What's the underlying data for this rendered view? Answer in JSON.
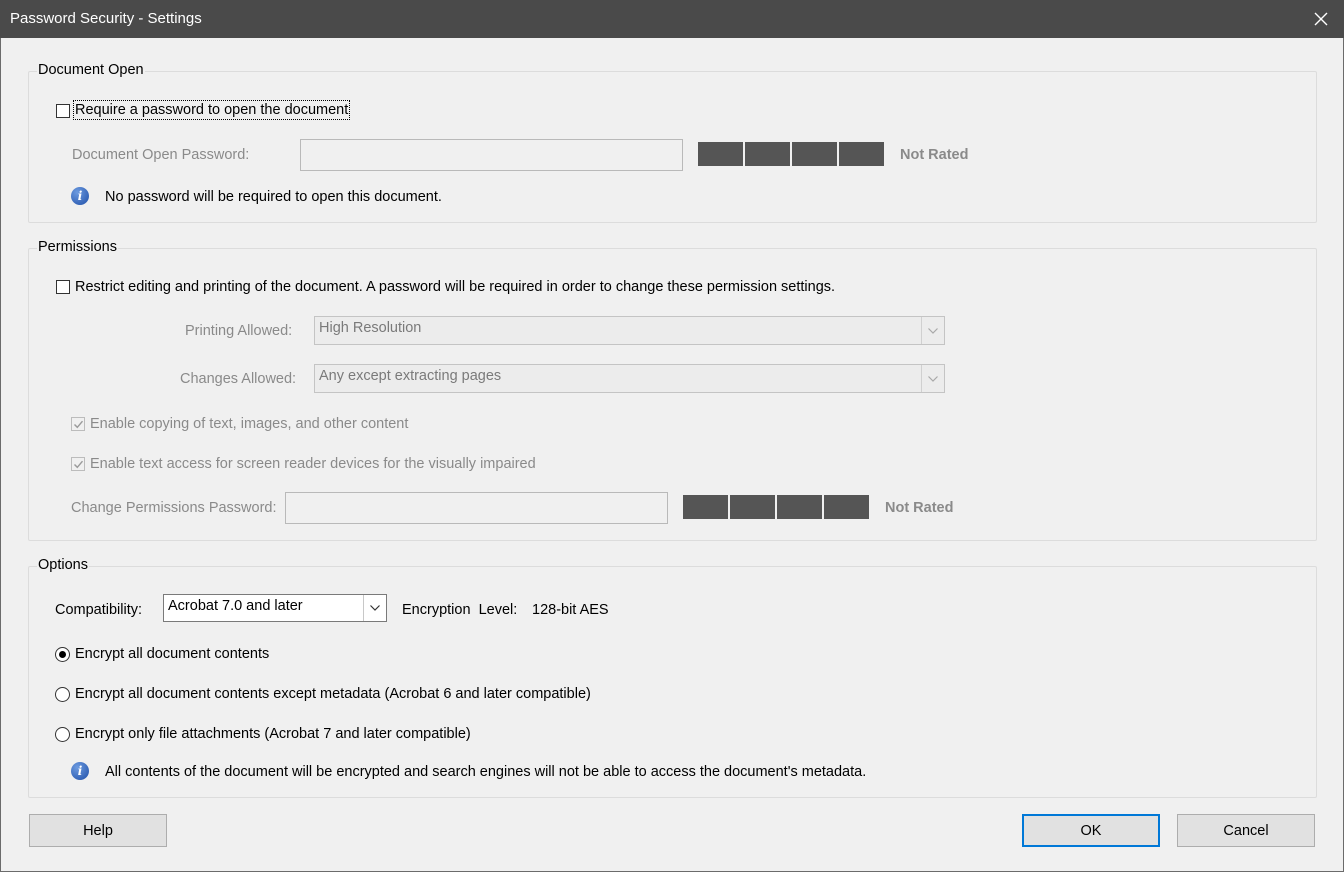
{
  "window": {
    "title": "Password Security - Settings"
  },
  "document_open": {
    "legend": "Document Open",
    "require_password_label": "Require a password to open the document",
    "require_password_checked": false,
    "password_label": "Document Open Password:",
    "password_value": "",
    "strength_rating": "Not Rated",
    "info_text": "No password will be required to open this document."
  },
  "permissions": {
    "legend": "Permissions",
    "restrict_label": "Restrict editing and printing of the document. A password will be required in order to change these permission settings.",
    "restrict_checked": false,
    "printing_label": "Printing Allowed:",
    "printing_value": "High Resolution",
    "changes_label": "Changes Allowed:",
    "changes_value": "Any except extracting pages",
    "copy_label": "Enable copying of text, images, and other content",
    "copy_checked": true,
    "screen_reader_label": "Enable text access for screen reader devices for the visually impaired",
    "screen_reader_checked": true,
    "password_label": "Change Permissions Password:",
    "password_value": "",
    "strength_rating": "Not Rated"
  },
  "options": {
    "legend": "Options",
    "compatibility_label": "Compatibility:",
    "compatibility_value": "Acrobat 7.0 and later",
    "encryption_label": "Encryption  Level:",
    "encryption_value": "128-bit AES",
    "radio_all": "Encrypt all document contents",
    "radio_except_metadata": "Encrypt all document contents except metadata (Acrobat 6 and later compatible)",
    "radio_attachments": "Encrypt only file attachments (Acrobat 7 and later compatible)",
    "selected_radio": "all",
    "info_text": "All contents of the document will be encrypted and search engines will not be able to access the document's metadata."
  },
  "buttons": {
    "help": "Help",
    "ok": "OK",
    "cancel": "Cancel"
  },
  "icons": {
    "close": "close-icon",
    "info": "info-icon",
    "dropdown": "chevron-down-icon",
    "check": "checkmark-icon"
  },
  "colors": {
    "titlebar": "#4a4a4a",
    "background": "#f0f0f0",
    "meter": "#555555",
    "default_button_border": "#0078d7",
    "info_icon": "#1f4fa8"
  }
}
